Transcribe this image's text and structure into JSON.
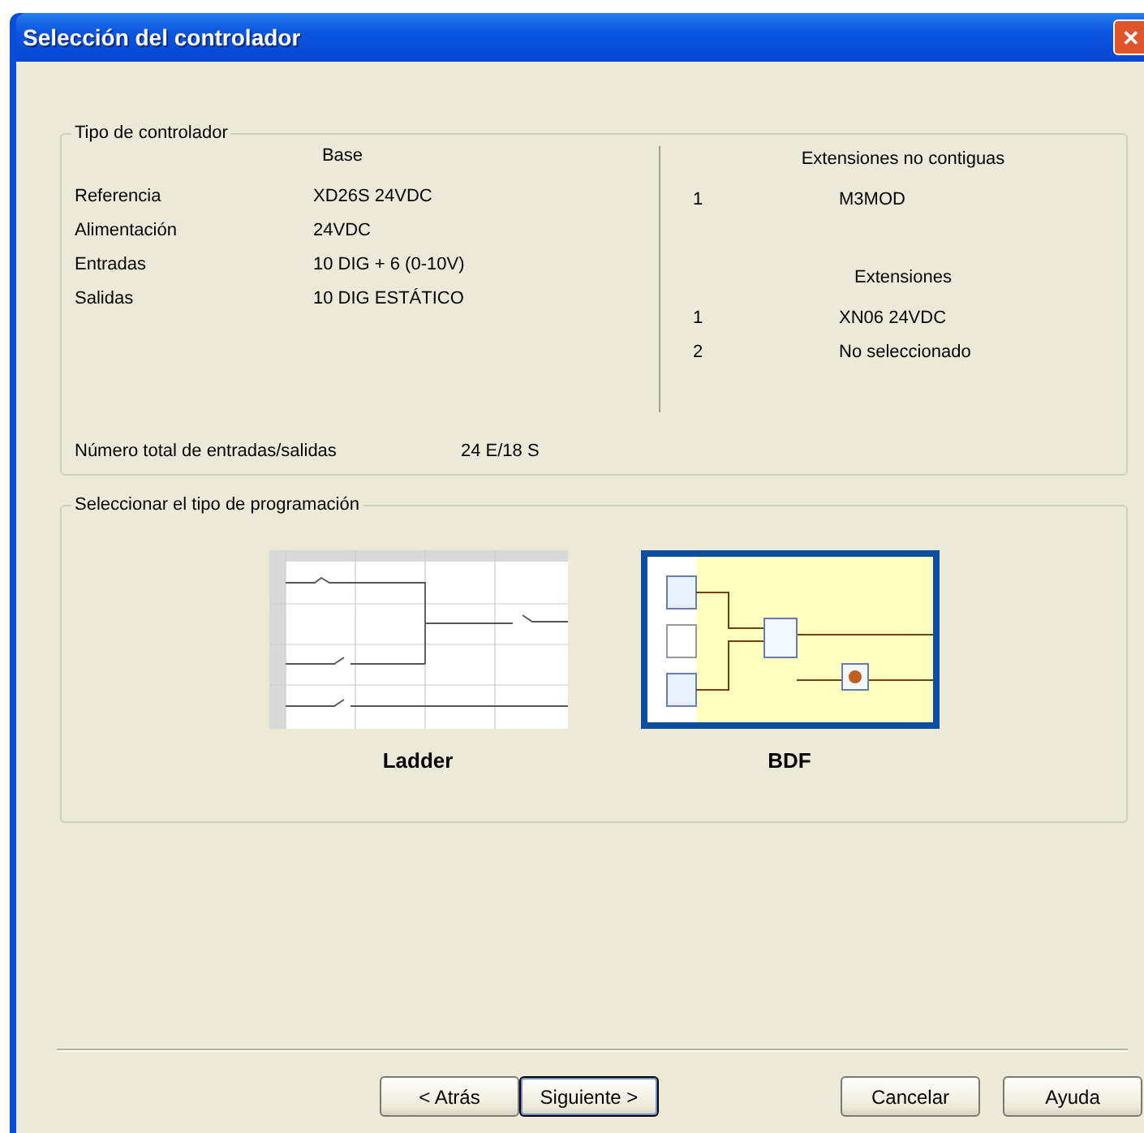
{
  "window": {
    "title": "Selección del controlador",
    "close_label": "✕"
  },
  "controller_group": {
    "title": "Tipo de controlador",
    "base_heading": "Base",
    "base_rows": [
      {
        "label": "Referencia",
        "value": "XD26S 24VDC"
      },
      {
        "label": "Alimentación",
        "value": "24VDC"
      },
      {
        "label": "Entradas",
        "value": "10 DIG + 6 (0-10V)"
      },
      {
        "label": "Salidas",
        "value": "10 DIG ESTÁTICO"
      }
    ],
    "noncontiguous_heading": "Extensiones no contiguas",
    "noncontiguous": [
      {
        "index": "1",
        "value": "M3MOD"
      }
    ],
    "extensions_heading": "Extensiones",
    "extensions": [
      {
        "index": "1",
        "value": "XN06  24VDC"
      },
      {
        "index": "2",
        "value": "No seleccionado"
      }
    ],
    "total_label": "Número total de entradas/salidas",
    "total_value": "24 E/18 S"
  },
  "programming_group": {
    "title": "Seleccionar el tipo de programación",
    "options": [
      {
        "kind": "ladder",
        "label": "Ladder",
        "selected": false
      },
      {
        "kind": "bdf",
        "label": "BDF",
        "selected": true
      }
    ]
  },
  "buttons": [
    {
      "label": "< Atrás",
      "default": false
    },
    {
      "label": "Siguiente >",
      "default": true
    },
    {
      "label": "Cancelar",
      "default": false
    },
    {
      "label": "Ayuda",
      "default": false
    }
  ]
}
